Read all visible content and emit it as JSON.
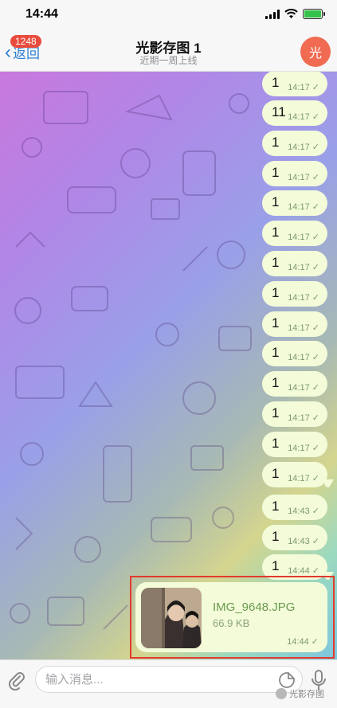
{
  "status_bar": {
    "time": "14:44"
  },
  "nav": {
    "back_label": "返回",
    "unread_count": "1248",
    "title": "光影存图 1",
    "subtitle": "近期一周上线",
    "avatar_letter": "光"
  },
  "messages": [
    {
      "text": "1",
      "time": "14:17"
    },
    {
      "text": "11",
      "time": "14:17"
    },
    {
      "text": "1",
      "time": "14:17"
    },
    {
      "text": "1",
      "time": "14:17"
    },
    {
      "text": "1",
      "time": "14:17"
    },
    {
      "text": "1",
      "time": "14:17"
    },
    {
      "text": "1",
      "time": "14:17"
    },
    {
      "text": "1",
      "time": "14:17"
    },
    {
      "text": "1",
      "time": "14:17"
    },
    {
      "text": "1",
      "time": "14:17"
    },
    {
      "text": "1",
      "time": "14:17"
    },
    {
      "text": "1",
      "time": "14:17"
    },
    {
      "text": "1",
      "time": "14:17"
    },
    {
      "text": "1",
      "time": "14:43"
    },
    {
      "text": "1",
      "time": "14:43"
    },
    {
      "text": "1",
      "time": "14:44"
    }
  ],
  "photo_message": {
    "file_name": "IMG_9648.JPG",
    "file_size": "66.9 KB",
    "time": "14:44"
  },
  "input": {
    "placeholder": "输入消息..."
  },
  "watermark": {
    "text": "光影存图"
  },
  "colors": {
    "accent": "#2f7fd6",
    "bubble": "#f3fbd9",
    "badge": "#e84b3c",
    "highlight": "#e23a2e"
  },
  "icons": [
    "chevron-left-icon",
    "attach-icon",
    "sticker-icon",
    "microphone-icon",
    "checkmark-icon"
  ]
}
